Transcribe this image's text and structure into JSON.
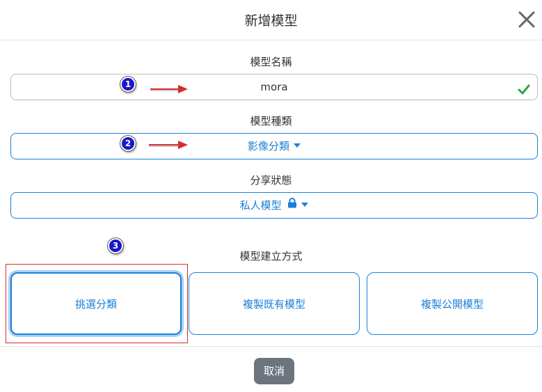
{
  "modal": {
    "title": "新增模型",
    "close_icon": "close-icon"
  },
  "form": {
    "name_label": "模型名稱",
    "name_value": "mora",
    "name_valid_icon": "check-icon",
    "type_label": "模型種類",
    "type_value": "影像分類",
    "share_label": "分享狀態",
    "share_value": "私人模型",
    "share_icon": "lock-icon",
    "method_label": "模型建立方式",
    "methods": [
      {
        "label": "挑選分類",
        "selected": true
      },
      {
        "label": "複製既有模型",
        "selected": false
      },
      {
        "label": "複製公開模型",
        "selected": false
      }
    ]
  },
  "annotations": {
    "markers": [
      "1",
      "2",
      "3"
    ]
  },
  "footer": {
    "cancel_label": "取消"
  },
  "colors": {
    "accent": "#1a7fd6",
    "valid": "#28a745",
    "cancel_bg": "#6c757d",
    "annotation_red": "#d92b2b",
    "marker_blue": "#1a18c8"
  }
}
